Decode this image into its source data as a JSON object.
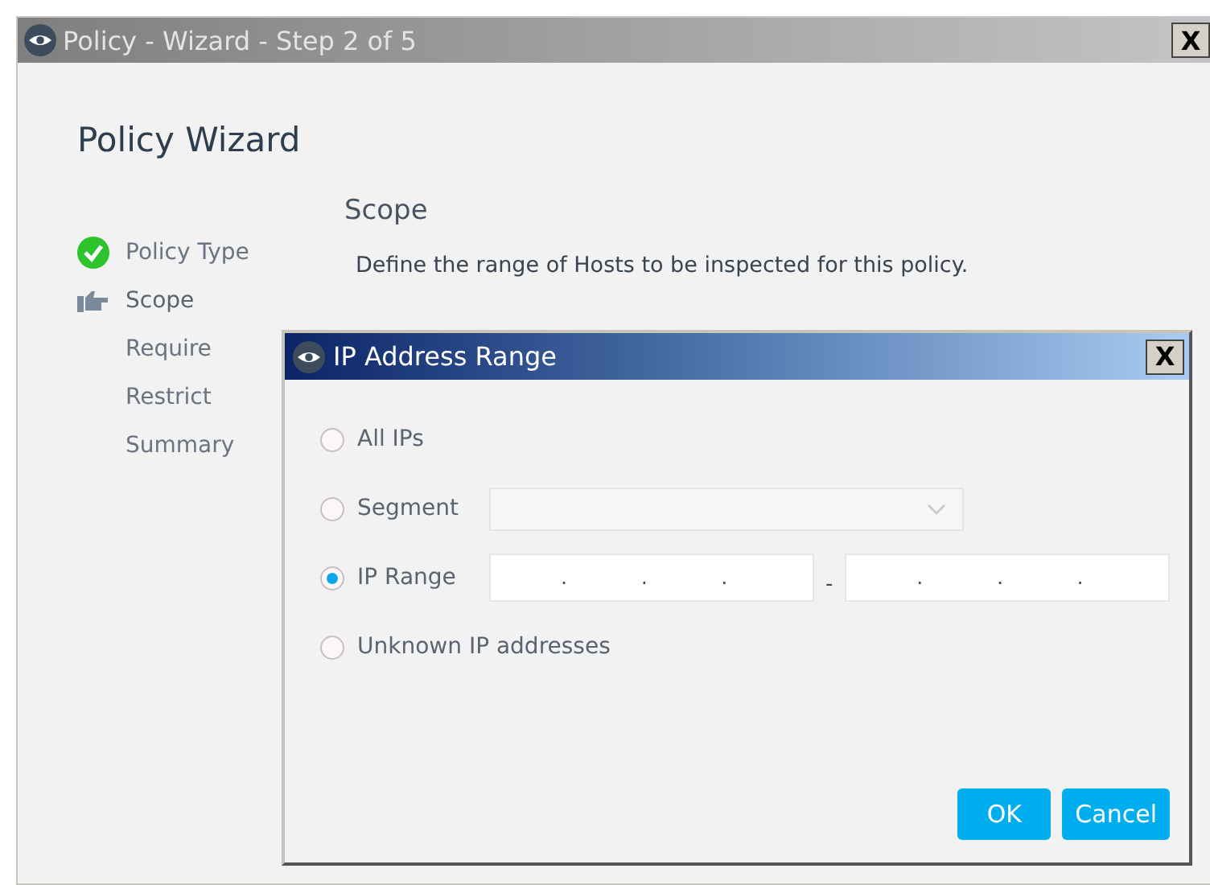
{
  "window": {
    "title": "Policy - Wizard - Step 2 of 5",
    "close": "X"
  },
  "heading": "Policy Wizard",
  "steps": [
    {
      "label": "Policy Type",
      "kind": "done"
    },
    {
      "label": "Scope",
      "kind": "current"
    },
    {
      "label": "Require",
      "kind": "pending"
    },
    {
      "label": "Restrict",
      "kind": "pending"
    },
    {
      "label": "Summary",
      "kind": "pending"
    }
  ],
  "section": {
    "title": "Scope",
    "description": "Define the range of Hosts to be inspected for this policy."
  },
  "dialog": {
    "title": "IP Address Range",
    "close": "X",
    "options": [
      {
        "label": "All IPs",
        "kind": "plain",
        "selected": false
      },
      {
        "label": "Segment",
        "kind": "dropdown",
        "selected": false
      },
      {
        "label": "IP Range",
        "kind": "range",
        "selected": true,
        "from_dots": [
          ".",
          ".",
          "."
        ],
        "separator": "-",
        "to_dots": [
          ".",
          ".",
          "."
        ]
      },
      {
        "label": "Unknown IP addresses",
        "kind": "plain",
        "selected": false
      }
    ],
    "buttons": [
      "OK",
      "Cancel"
    ]
  }
}
